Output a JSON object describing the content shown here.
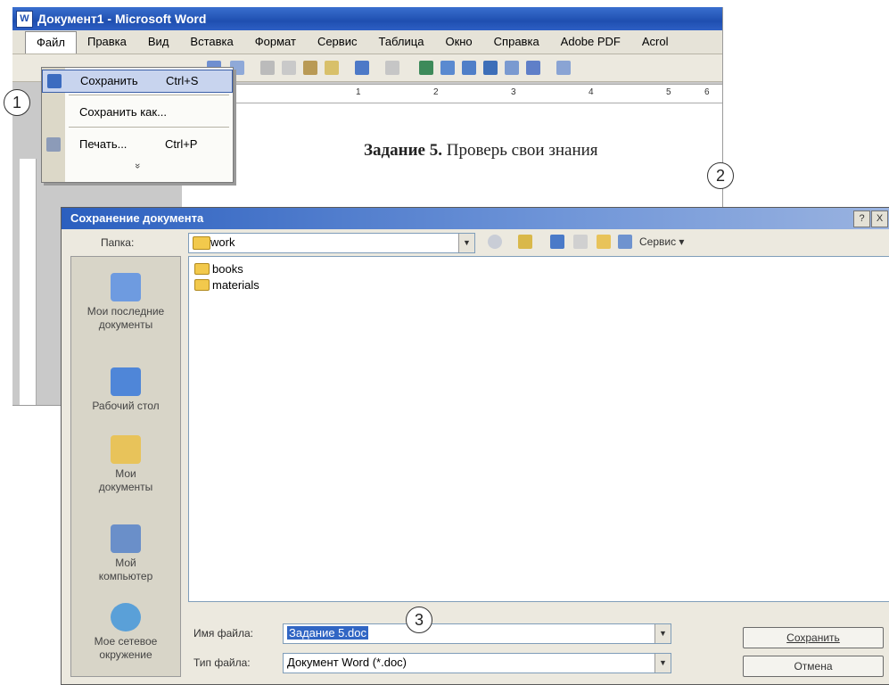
{
  "word": {
    "title": "Документ1 - Microsoft Word",
    "menu": [
      {
        "id": "file",
        "label": "Файл"
      },
      {
        "id": "edit",
        "label": "Правка"
      },
      {
        "id": "view",
        "label": "Вид"
      },
      {
        "id": "insert",
        "label": "Вставка"
      },
      {
        "id": "format",
        "label": "Формат"
      },
      {
        "id": "service",
        "label": "Сервис"
      },
      {
        "id": "table",
        "label": "Таблица"
      },
      {
        "id": "window",
        "label": "Окно"
      },
      {
        "id": "help",
        "label": "Справка"
      },
      {
        "id": "adobe",
        "label": "Adobe PDF"
      },
      {
        "id": "acrobat",
        "label": "Acrol"
      }
    ],
    "file_menu": {
      "save": {
        "label": "Сохранить",
        "shortcut": "Ctrl+S"
      },
      "save_as": {
        "label": "Сохранить как..."
      },
      "print": {
        "label": "Печать...",
        "shortcut": "Ctrl+P"
      },
      "more": "»"
    },
    "ruler": [
      "1",
      "2",
      "3",
      "4",
      "5",
      "6"
    ],
    "document_text": {
      "bold": "Задание 5.",
      "rest": " Проверь свои знания"
    }
  },
  "callouts": [
    "1",
    "2",
    "3"
  ],
  "dialog": {
    "title": "Сохранение документа",
    "help_btn": "?",
    "close_btn": "X",
    "folder_label": "Папка:",
    "folder_value": "work",
    "service_label": "Сервис",
    "places": [
      {
        "id": "recent",
        "label": "Мои последние документы",
        "icon_color": "#6e9be0"
      },
      {
        "id": "desktop",
        "label": "Рабочий стол",
        "icon_color": "#4f86d8"
      },
      {
        "id": "mydocs",
        "label": "Мои документы",
        "icon_color": "#e8c35a"
      },
      {
        "id": "mycomp",
        "label": "Мой компьютер",
        "icon_color": "#6a8fc9"
      },
      {
        "id": "network",
        "label": "Мое сетевое окружение",
        "icon_color": "#5aa0d8"
      }
    ],
    "files": [
      "books",
      "materials"
    ],
    "filename_label": "Имя файла:",
    "filename_value": "Задание 5.doc",
    "filetype_label": "Тип файла:",
    "filetype_value": "Документ Word (*.doc)",
    "save_button": "Сохранить",
    "cancel_button": "Отмена"
  }
}
